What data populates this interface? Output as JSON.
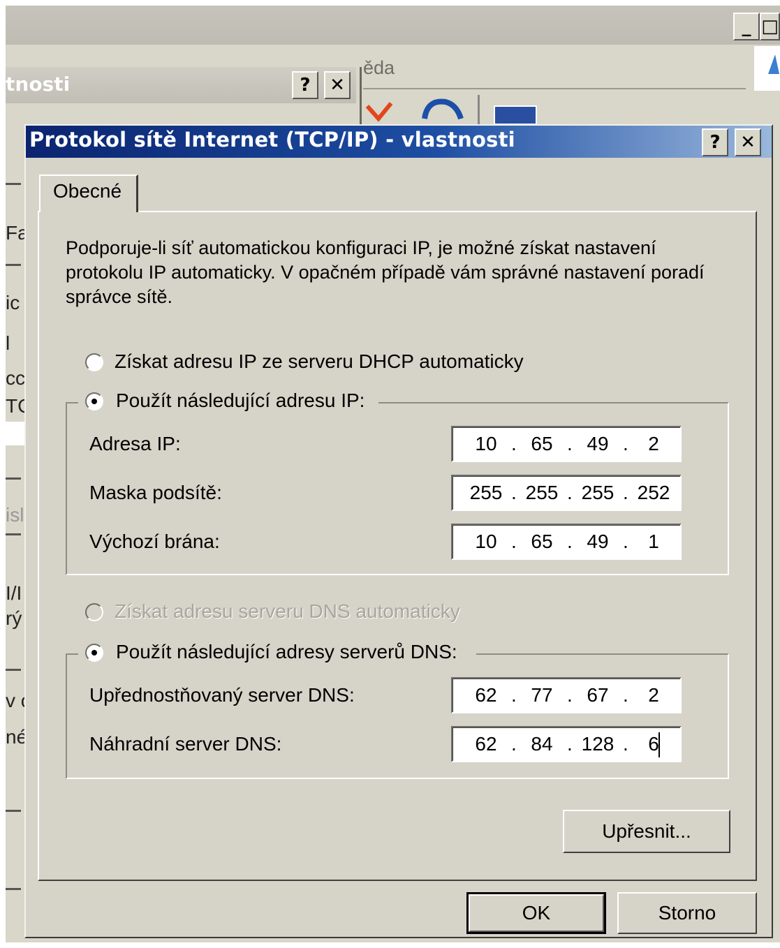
{
  "background": {
    "menu_fragment": "ěda",
    "dialog_title_fragment": "tnosti",
    "system_buttons": {
      "minimize": "_",
      "maximize": "□",
      "help": "?",
      "close": "✕"
    },
    "left_fragments": [
      "Fa",
      "ic",
      "l",
      "cc",
      "TC",
      "isl",
      "I/I",
      "rý",
      "v c",
      "né"
    ]
  },
  "dialog": {
    "title": "Protokol sítě Internet (TCP/IP) - vlastnosti",
    "help_label": "?",
    "close_label": "✕",
    "tab_label": "Obecné",
    "description": "Podporuje-li síť automatickou konfiguraci IP, je možné získat nastavení protokolu IP automaticky. V opačném případě vám správné nastavení poradí správce sítě.",
    "ip": {
      "auto_label": "Získat adresu IP ze serveru DHCP automaticky",
      "manual_label": "Použít následující adresu IP:",
      "selected": "manual",
      "fields": [
        {
          "label": "Adresa IP:",
          "octets": [
            "10",
            "65",
            "49",
            "2"
          ]
        },
        {
          "label": "Maska podsítě:",
          "octets": [
            "255",
            "255",
            "255",
            "252"
          ]
        },
        {
          "label": "Výchozí brána:",
          "octets": [
            "10",
            "65",
            "49",
            "1"
          ]
        }
      ]
    },
    "dns": {
      "auto_label": "Získat adresu serveru DNS automaticky",
      "auto_enabled": false,
      "manual_label": "Použít následující adresy serverů DNS:",
      "selected": "manual",
      "fields": [
        {
          "label": "Upřednostňovaný server DNS:",
          "octets": [
            "62",
            "77",
            "67",
            "2"
          ]
        },
        {
          "label": "Náhradní server DNS:",
          "octets": [
            "62",
            "84",
            "128",
            "6"
          ]
        }
      ]
    },
    "advanced_label": "Upřesnit...",
    "ok_label": "OK",
    "cancel_label": "Storno"
  },
  "colors": {
    "title_gradient_start": "#0b2470",
    "title_gradient_end": "#9ab7dc",
    "dialog_face": "#d6d3c8",
    "disabled_text": "#a8a69d"
  }
}
